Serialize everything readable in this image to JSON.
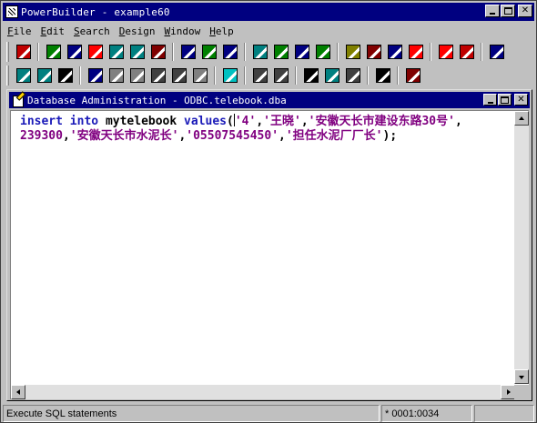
{
  "app": {
    "title": "PowerBuilder - example60"
  },
  "menubar": {
    "items": [
      {
        "label": "File",
        "mnemonic": "F",
        "rest": "ile"
      },
      {
        "label": "Edit",
        "mnemonic": "E",
        "rest": "dit"
      },
      {
        "label": "Search",
        "mnemonic": "S",
        "rest": "earch"
      },
      {
        "label": "Design",
        "mnemonic": "D",
        "rest": "esign"
      },
      {
        "label": "Window",
        "mnemonic": "W",
        "rest": "indow"
      },
      {
        "label": "Help",
        "mnemonic": "H",
        "rest": "elp"
      }
    ]
  },
  "toolbar1": {
    "buttons": [
      {
        "icon": "application-icon",
        "color": "#c00000"
      },
      {
        "icon": "window-painter-icon",
        "color": "#008000"
      },
      {
        "icon": "user-object-icon",
        "color": "#000080"
      },
      {
        "icon": "menu-painter-icon",
        "color": "#ff0000"
      },
      {
        "icon": "structure-icon",
        "color": "#008080"
      },
      {
        "icon": "function-icon",
        "color": "#008080"
      },
      {
        "icon": "project-icon",
        "color": "#800000"
      },
      {
        "icon": "datawindow-icon",
        "color": "#000080"
      },
      {
        "icon": "query-icon",
        "color": "#008000"
      },
      {
        "icon": "pipeline-icon",
        "color": "#000080"
      },
      {
        "icon": "database-icon",
        "color": "#008080"
      },
      {
        "icon": "db-profile-icon",
        "color": "#008000"
      },
      {
        "icon": "db-admin-icon",
        "color": "#000080"
      },
      {
        "icon": "library-icon",
        "color": "#008000"
      },
      {
        "icon": "run-window-icon",
        "color": "#808000"
      },
      {
        "icon": "browser-icon",
        "color": "#800000"
      },
      {
        "icon": "edit-icon",
        "color": "#000080"
      },
      {
        "icon": "object-browser-icon",
        "color": "#ff0000"
      },
      {
        "icon": "run-icon",
        "color": "#ff0000"
      },
      {
        "icon": "debug-icon",
        "color": "#c00000"
      },
      {
        "icon": "exit-icon",
        "color": "#000080"
      }
    ]
  },
  "toolbar2": {
    "buttons": [
      {
        "icon": "new-icon",
        "color": "#008080"
      },
      {
        "icon": "open-icon",
        "color": "#008080"
      },
      {
        "icon": "save-icon",
        "color": "#000000"
      },
      {
        "icon": "undo-icon",
        "color": "#000080"
      },
      {
        "icon": "cut-icon",
        "color": "#808080"
      },
      {
        "icon": "copy-icon",
        "color": "#808080"
      },
      {
        "icon": "paste-icon",
        "color": "#404040"
      },
      {
        "icon": "paste-sql-icon",
        "color": "#404040"
      },
      {
        "icon": "clear-icon",
        "color": "#808080"
      },
      {
        "icon": "select-all-icon",
        "color": "#00c0c0"
      },
      {
        "icon": "comment-icon",
        "color": "#404040"
      },
      {
        "icon": "uncomment-icon",
        "color": "#404040"
      },
      {
        "icon": "find-icon",
        "color": "#000000"
      },
      {
        "icon": "replace-icon",
        "color": "#008080"
      },
      {
        "icon": "find-next-icon",
        "color": "#404040"
      },
      {
        "icon": "execute-icon",
        "color": "#000000"
      },
      {
        "icon": "close-sql-icon",
        "color": "#800000"
      }
    ]
  },
  "child_window": {
    "title": "Database Administration - ODBC.telebook.dba"
  },
  "editor": {
    "line1": {
      "kw1": "insert",
      "kw2": "into",
      "table": "mytelebook",
      "kw3": "values",
      "paren": "(",
      "v1": "'4'",
      "comma1": ",",
      "v2": "'王晓'",
      "comma2": ",",
      "v3": "'安徽天长市建设东路30号'",
      "comma3": ","
    },
    "line2": {
      "v4": "239300",
      "comma4": ",",
      "v5": "'安徽天长市水泥长'",
      "comma5": ",",
      "v6": "'05507545450'",
      "comma6": ",",
      "v7": "'担任水泥厂厂长'",
      "close": ");"
    }
  },
  "statusbar": {
    "message": "Execute SQL statements",
    "position": "* 0001:0034"
  }
}
